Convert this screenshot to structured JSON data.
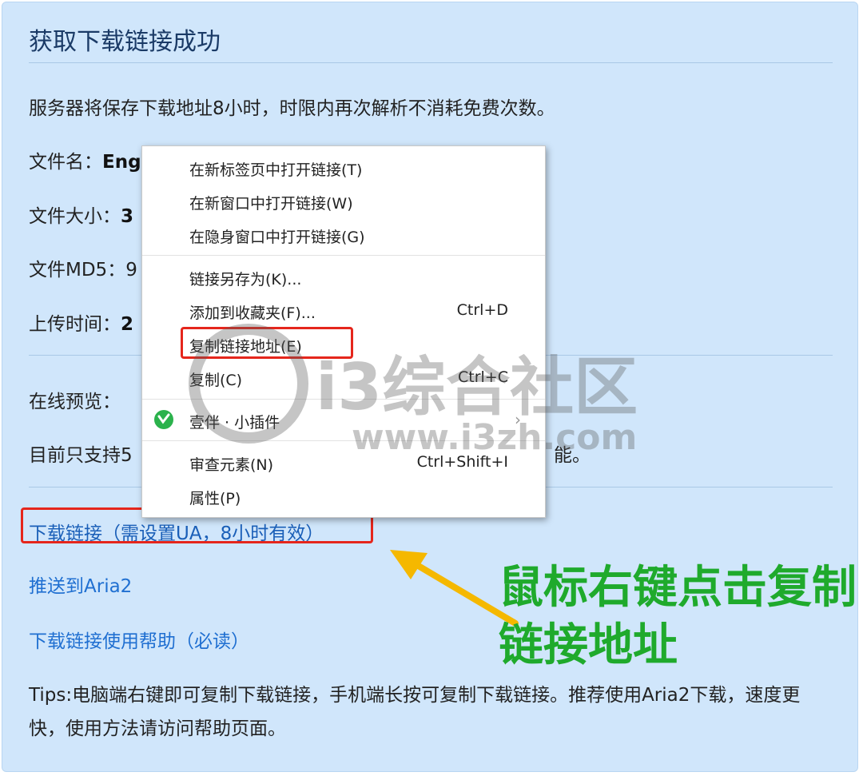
{
  "panel": {
    "title": "获取下载链接成功",
    "notice": "服务器将保存下载地址8小时，时限内再次解析不消耗免费次数。",
    "file_name_label": "文件名：",
    "file_name_value": "Eng",
    "file_size_label": "文件大小：",
    "file_size_value": "3",
    "file_md5_label": "文件MD5：",
    "file_md5_value": "9",
    "upload_time_label": "上传时间：",
    "upload_time_value": "2",
    "preview_label": "在线预览：",
    "support_prefix": "目前只支持5",
    "support_suffix": "能。",
    "download_link": "下载链接（需设置UA，8小时有效）",
    "aria2_link": "推送到Aria2",
    "help_link": "下载链接使用帮助（必读）",
    "tips": "Tips:电脑端右键即可复制下载链接，手机端长按可复制下载链接。推荐使用Aria2下载，速度更快，使用方法请访问帮助页面。"
  },
  "context_menu": {
    "items": [
      {
        "label": "在新标签页中打开链接(T)"
      },
      {
        "label": "在新窗口中打开链接(W)"
      },
      {
        "label": "在隐身窗口中打开链接(G)"
      },
      {
        "label": "链接另存为(K)..."
      },
      {
        "label": "添加到收藏夹(F)...",
        "shortcut": "Ctrl+D"
      },
      {
        "label": "复制链接地址(E)"
      },
      {
        "label": "复制(C)",
        "shortcut": "Ctrl+C"
      },
      {
        "label": "壹伴 · 小插件"
      },
      {
        "label": "审查元素(N)",
        "shortcut": "Ctrl+Shift+I"
      },
      {
        "label": "属性(P)"
      }
    ]
  },
  "annotation": {
    "line1": "鼠标右键点击复制",
    "line2": "链接地址",
    "colors": {
      "text": "#1faa2c",
      "arrow": "#f5b800",
      "highlight": "#e5261c"
    }
  },
  "watermark": {
    "brand": "i3综合社区",
    "url": "www.i3zh.com"
  }
}
